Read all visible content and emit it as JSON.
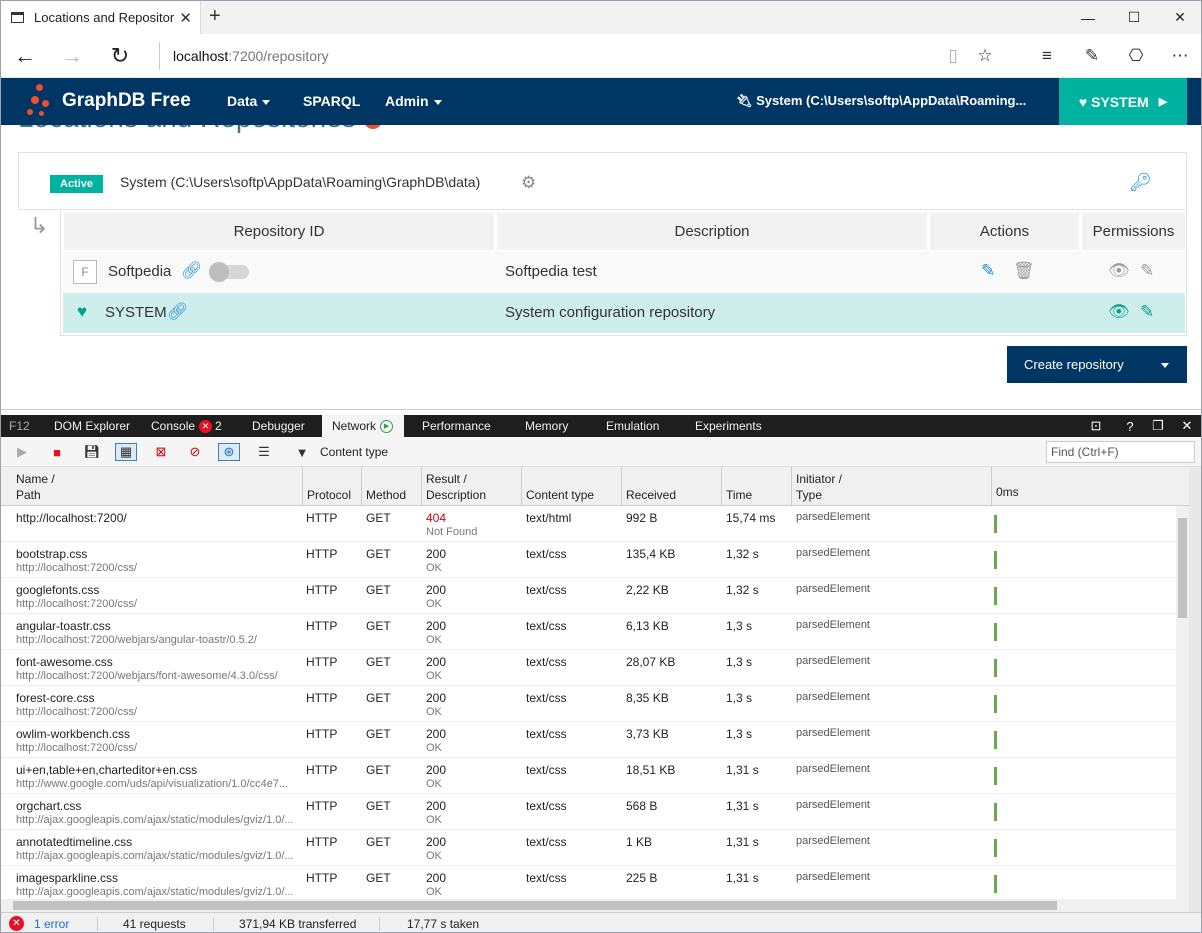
{
  "browser": {
    "tab_title": "Locations and Repositor",
    "url_host": "localhost",
    "url_rest": ":7200/repository"
  },
  "app": {
    "brand": "GraphDB Free",
    "menu": {
      "data": "Data",
      "sparql": "SPARQL",
      "admin": "Admin"
    },
    "location": "System (C:\\Users\\softp\\AppData\\Roaming...",
    "system_button": "SYSTEM"
  },
  "page": {
    "title": "Locations and Repositories",
    "active_badge": "Active",
    "location_path": "System (C:\\Users\\softp\\AppData\\Roaming\\GraphDB\\data)",
    "table_headers": {
      "id": "Repository ID",
      "description": "Description",
      "actions": "Actions",
      "permissions": "Permissions"
    },
    "repos": [
      {
        "type_letter": "F",
        "id": "Softpedia",
        "description": "Softpedia test"
      },
      {
        "id": "SYSTEM",
        "description": "System configuration repository"
      }
    ],
    "create_button": "Create repository"
  },
  "devtools": {
    "tabs": {
      "f12": "F12",
      "dom": "DOM Explorer",
      "console": "Console",
      "console_errors": "2",
      "debugger": "Debugger",
      "network": "Network",
      "performance": "Performance",
      "memory": "Memory",
      "emulation": "Emulation",
      "experiments": "Experiments"
    },
    "content_type_label": "Content type",
    "find_placeholder": "Find (Ctrl+F)",
    "columns": {
      "name": "Name /",
      "path": "Path",
      "protocol": "Protocol",
      "method": "Method",
      "result": "Result /",
      "result_desc": "Description",
      "content_type": "Content type",
      "received": "Received",
      "time": "Time",
      "initiator": "Initiator /",
      "initiator_type": "Type",
      "timeline": "0ms"
    },
    "requests": [
      {
        "name": "http://localhost:7200/",
        "path": "",
        "protocol": "HTTP",
        "method": "GET",
        "status": "404",
        "status_text": "Not Found",
        "content_type": "text/html",
        "received": "992 B",
        "time": "15,74 ms",
        "initiator": "parsedElement"
      },
      {
        "name": "bootstrap.css",
        "path": "http://localhost:7200/css/",
        "protocol": "HTTP",
        "method": "GET",
        "status": "200",
        "status_text": "OK",
        "content_type": "text/css",
        "received": "135,4 KB",
        "time": "1,32 s",
        "initiator": "parsedElement"
      },
      {
        "name": "googlefonts.css",
        "path": "http://localhost:7200/css/",
        "protocol": "HTTP",
        "method": "GET",
        "status": "200",
        "status_text": "OK",
        "content_type": "text/css",
        "received": "2,22 KB",
        "time": "1,32 s",
        "initiator": "parsedElement"
      },
      {
        "name": "angular-toastr.css",
        "path": "http://localhost:7200/webjars/angular-toastr/0.5.2/",
        "protocol": "HTTP",
        "method": "GET",
        "status": "200",
        "status_text": "OK",
        "content_type": "text/css",
        "received": "6,13 KB",
        "time": "1,3 s",
        "initiator": "parsedElement"
      },
      {
        "name": "font-awesome.css",
        "path": "http://localhost:7200/webjars/font-awesome/4.3.0/css/",
        "protocol": "HTTP",
        "method": "GET",
        "status": "200",
        "status_text": "OK",
        "content_type": "text/css",
        "received": "28,07 KB",
        "time": "1,3 s",
        "initiator": "parsedElement"
      },
      {
        "name": "forest-core.css",
        "path": "http://localhost:7200/css/",
        "protocol": "HTTP",
        "method": "GET",
        "status": "200",
        "status_text": "OK",
        "content_type": "text/css",
        "received": "8,35 KB",
        "time": "1,3 s",
        "initiator": "parsedElement"
      },
      {
        "name": "owlim-workbench.css",
        "path": "http://localhost:7200/css/",
        "protocol": "HTTP",
        "method": "GET",
        "status": "200",
        "status_text": "OK",
        "content_type": "text/css",
        "received": "3,73 KB",
        "time": "1,3 s",
        "initiator": "parsedElement"
      },
      {
        "name": "ui+en,table+en,charteditor+en.css",
        "path": "http://www.google.com/uds/api/visualization/1.0/cc4e7...",
        "protocol": "HTTP",
        "method": "GET",
        "status": "200",
        "status_text": "OK",
        "content_type": "text/css",
        "received": "18,51 KB",
        "time": "1,31 s",
        "initiator": "parsedElement"
      },
      {
        "name": "orgchart.css",
        "path": "http://ajax.googleapis.com/ajax/static/modules/gviz/1.0/...",
        "protocol": "HTTP",
        "method": "GET",
        "status": "200",
        "status_text": "OK",
        "content_type": "text/css",
        "received": "568 B",
        "time": "1,31 s",
        "initiator": "parsedElement"
      },
      {
        "name": "annotatedtimeline.css",
        "path": "http://ajax.googleapis.com/ajax/static/modules/gviz/1.0/...",
        "protocol": "HTTP",
        "method": "GET",
        "status": "200",
        "status_text": "OK",
        "content_type": "text/css",
        "received": "1 KB",
        "time": "1,31 s",
        "initiator": "parsedElement"
      },
      {
        "name": "imagesparkline.css",
        "path": "http://ajax.googleapis.com/ajax/static/modules/gviz/1.0/...",
        "protocol": "HTTP",
        "method": "GET",
        "status": "200",
        "status_text": "OK",
        "content_type": "text/css",
        "received": "225 B",
        "time": "1,31 s",
        "initiator": "parsedElement"
      }
    ],
    "status": {
      "errors": "1 error",
      "requests": "41 requests",
      "transferred": "371,94 KB transferred",
      "taken": "17,77 s taken"
    }
  },
  "colors": {
    "nav": "#003663",
    "accent": "#00b2a0",
    "logo": "#ed4f2f",
    "error": "#e81123"
  }
}
